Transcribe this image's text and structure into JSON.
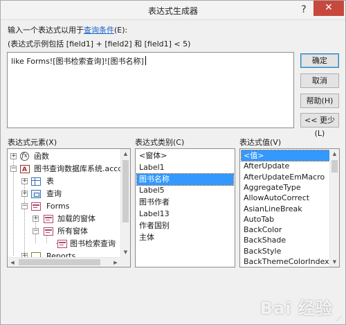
{
  "window": {
    "title": "表达式生成器",
    "help_glyph": "?",
    "close_glyph": "✕"
  },
  "prompt": {
    "line1_prefix": "输入一个表达式以用于",
    "line1_link": "查询条件",
    "line1_suffix": "(E):",
    "line2": "(表达式示例包括 [field1] + [field2] 和 [field1] < 5)"
  },
  "expression": {
    "value": "like Forms![图书检索查询]![图书名称]"
  },
  "buttons": {
    "ok": "确定",
    "cancel": "取消",
    "help": "帮助(H)",
    "less": "<< 更少(L)"
  },
  "elements_panel": {
    "label": "表达式元素(X)",
    "items": [
      {
        "label": "函数",
        "icon": "function-icon",
        "toggle": "+"
      },
      {
        "label": "图书查询数据库系统.accdb",
        "icon": "database-icon",
        "toggle": "−"
      },
      {
        "label": "表",
        "icon": "table-icon",
        "toggle": "+"
      },
      {
        "label": "查询",
        "icon": "query-icon",
        "toggle": "+"
      },
      {
        "label": "Forms",
        "icon": "form-icon",
        "toggle": "−"
      },
      {
        "label": "加载的窗体",
        "icon": "form-icon",
        "toggle": "+"
      },
      {
        "label": "所有窗体",
        "icon": "form-icon",
        "toggle": "−"
      },
      {
        "label": "图书检索查询",
        "icon": "form-icon",
        "toggle": ""
      },
      {
        "label": "Reports",
        "icon": "report-icon",
        "toggle": "+"
      }
    ]
  },
  "categories_panel": {
    "label": "表达式类别(C)",
    "items": [
      "<窗体>",
      "Label1",
      "图书名称",
      "Label5",
      "图书作者",
      "Label13",
      "作者国别",
      "主体"
    ],
    "selected": "图书名称"
  },
  "values_panel": {
    "label": "表达式值(V)",
    "items": [
      "<值>",
      "AfterUpdate",
      "AfterUpdateEmMacro",
      "AggregateType",
      "AllowAutoCorrect",
      "AsianLineBreak",
      "AutoTab",
      "BackColor",
      "BackShade",
      "BackStyle",
      "BackThemeColorIndex"
    ],
    "selected": "<值>"
  },
  "watermark": {
    "text": "Bai 经验"
  }
}
